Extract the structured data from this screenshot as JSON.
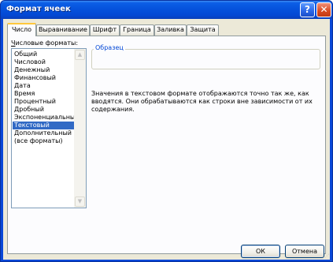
{
  "window": {
    "title": "Формат ячеек",
    "help_button": "?",
    "close_button": "✕"
  },
  "tabs": [
    {
      "label": "Число",
      "active": true
    },
    {
      "label": "Выравнивание",
      "active": false
    },
    {
      "label": "Шрифт",
      "active": false
    },
    {
      "label": "Граница",
      "active": false
    },
    {
      "label": "Заливка",
      "active": false
    },
    {
      "label": "Защита",
      "active": false
    }
  ],
  "formats": {
    "label_first_letter": "Ч",
    "label_rest": "исловые форматы:",
    "items": [
      "Общий",
      "Числовой",
      "Денежный",
      "Финансовый",
      "Дата",
      "Время",
      "Процентный",
      "Дробный",
      "Экспоненциальный",
      "Текстовый",
      "Дополнительный",
      "(все форматы)"
    ],
    "selected": "Текстовый"
  },
  "sample": {
    "legend": "Образец",
    "value": ""
  },
  "description": "Значения в текстовом формате отображаются точно так же, как вводятся. Они обрабатываются как строки вне зависимости от их содержания.",
  "buttons": {
    "ok": "ОК",
    "cancel": "Отмена"
  },
  "colors": {
    "title_bar": "#0552dc",
    "selection": "#316ac5",
    "legend_text": "#0046d5",
    "dialog_bg": "#ece9d8"
  }
}
